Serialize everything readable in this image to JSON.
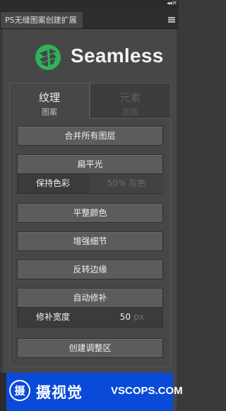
{
  "panel": {
    "title": "PS无缝图案创建扩展",
    "collapse_glyph": "◂◂",
    "close_glyph": "✕",
    "menu_icon": "hamburger-menu-icon"
  },
  "logo": {
    "text": "Seamless",
    "icon": "seamless-logo-icon",
    "color": "#2fb35a"
  },
  "tabs": [
    {
      "title": "纹理",
      "subtitle": "图案",
      "active": true
    },
    {
      "title": "元素",
      "subtitle": "图案",
      "active": false
    }
  ],
  "actions": {
    "merge_layers": "合并所有图层",
    "flatten_light": "扁平光",
    "keep_color_label": "保持色彩",
    "gray_percent": "50% 灰色",
    "flatten_color": "平整颜色",
    "enhance_detail": "增强细节",
    "invert_edge": "反转边缘",
    "auto_patch": "自动修补",
    "patch_width_label": "修补宽度",
    "patch_width_value": "50",
    "patch_width_unit": "px",
    "create_adjust": "创建调整区"
  },
  "watermark": {
    "cn_text": "摄视觉",
    "en_text": "VSCOPS.COM",
    "badge_char": "摄"
  }
}
